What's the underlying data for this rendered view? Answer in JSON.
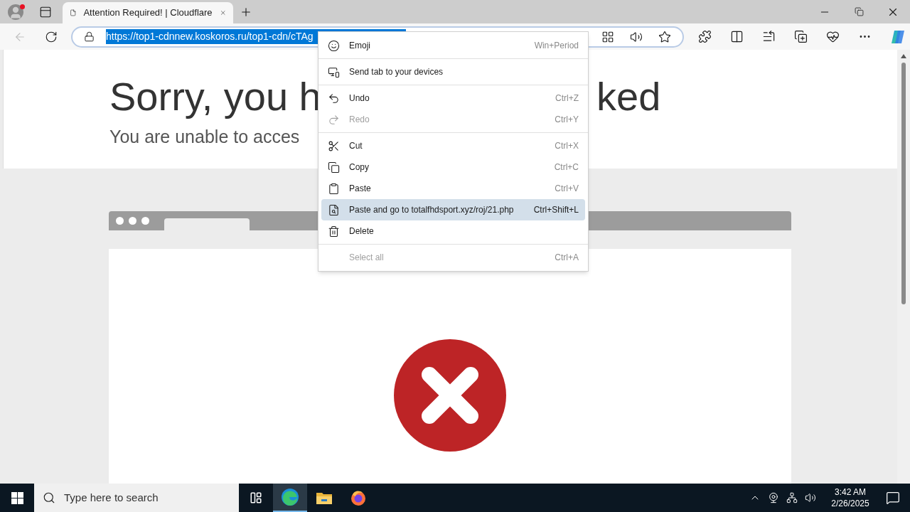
{
  "browser": {
    "tabs": [
      {
        "title": "Attention Required! | Cloudflare",
        "selected": true
      }
    ],
    "address": {
      "value": "https://top1-cdnnew.koskoros.ru/top1-cdn/cTAg",
      "selected": true
    }
  },
  "page": {
    "headline_parts": [
      "Sorry, you h",
      "ked"
    ],
    "subtitle": "You are unable to acces"
  },
  "context_menu": {
    "items": [
      {
        "kind": "item",
        "label": "Emoji",
        "shortcut": "Win+Period",
        "disabled": false,
        "selected": false
      },
      {
        "kind": "separator"
      },
      {
        "kind": "item",
        "label": "Send tab to your devices",
        "disabled": false,
        "selected": false
      },
      {
        "kind": "separator"
      },
      {
        "kind": "item",
        "label": "Undo",
        "shortcut": "Ctrl+Z",
        "disabled": false,
        "selected": false
      },
      {
        "kind": "item",
        "label": "Redo",
        "shortcut": "Ctrl+Y",
        "disabled": true,
        "selected": false
      },
      {
        "kind": "separator"
      },
      {
        "kind": "item",
        "label": "Cut",
        "shortcut": "Ctrl+X",
        "disabled": false,
        "selected": false
      },
      {
        "kind": "item",
        "label": "Copy",
        "shortcut": "Ctrl+C",
        "disabled": false,
        "selected": false
      },
      {
        "kind": "item",
        "label": "Paste",
        "shortcut": "Ctrl+V",
        "disabled": false,
        "selected": false
      },
      {
        "kind": "item",
        "label": "Paste and go to totalfhdsport.xyz/roj/21.php",
        "shortcut": "Ctrl+Shift+L",
        "disabled": false,
        "selected": true
      },
      {
        "kind": "item",
        "label": "Delete",
        "disabled": false,
        "selected": false
      },
      {
        "kind": "separator"
      },
      {
        "kind": "item",
        "label": "Select all",
        "shortcut": "Ctrl+A",
        "disabled": true,
        "selected": false
      }
    ]
  },
  "taskbar": {
    "search": {
      "placeholder": "Type here to search"
    },
    "apps": [
      {
        "selected": false
      },
      {
        "selected": true
      },
      {
        "selected": false
      },
      {
        "selected": false
      }
    ],
    "clock": {
      "time": "3:42 AM",
      "date": "2/26/2025"
    }
  }
}
